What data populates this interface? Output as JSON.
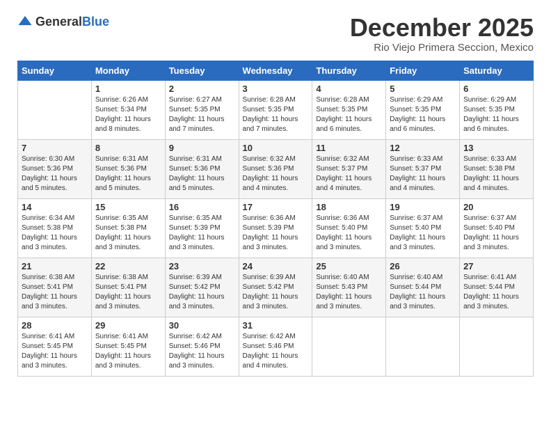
{
  "header": {
    "logo_general": "General",
    "logo_blue": "Blue",
    "month": "December 2025",
    "location": "Rio Viejo Primera Seccion, Mexico"
  },
  "calendar": {
    "weekdays": [
      "Sunday",
      "Monday",
      "Tuesday",
      "Wednesday",
      "Thursday",
      "Friday",
      "Saturday"
    ],
    "weeks": [
      [
        {
          "day": "",
          "info": ""
        },
        {
          "day": "1",
          "info": "Sunrise: 6:26 AM\nSunset: 5:34 PM\nDaylight: 11 hours\nand 8 minutes."
        },
        {
          "day": "2",
          "info": "Sunrise: 6:27 AM\nSunset: 5:35 PM\nDaylight: 11 hours\nand 7 minutes."
        },
        {
          "day": "3",
          "info": "Sunrise: 6:28 AM\nSunset: 5:35 PM\nDaylight: 11 hours\nand 7 minutes."
        },
        {
          "day": "4",
          "info": "Sunrise: 6:28 AM\nSunset: 5:35 PM\nDaylight: 11 hours\nand 6 minutes."
        },
        {
          "day": "5",
          "info": "Sunrise: 6:29 AM\nSunset: 5:35 PM\nDaylight: 11 hours\nand 6 minutes."
        },
        {
          "day": "6",
          "info": "Sunrise: 6:29 AM\nSunset: 5:35 PM\nDaylight: 11 hours\nand 6 minutes."
        }
      ],
      [
        {
          "day": "7",
          "info": "Sunrise: 6:30 AM\nSunset: 5:36 PM\nDaylight: 11 hours\nand 5 minutes."
        },
        {
          "day": "8",
          "info": "Sunrise: 6:31 AM\nSunset: 5:36 PM\nDaylight: 11 hours\nand 5 minutes."
        },
        {
          "day": "9",
          "info": "Sunrise: 6:31 AM\nSunset: 5:36 PM\nDaylight: 11 hours\nand 5 minutes."
        },
        {
          "day": "10",
          "info": "Sunrise: 6:32 AM\nSunset: 5:36 PM\nDaylight: 11 hours\nand 4 minutes."
        },
        {
          "day": "11",
          "info": "Sunrise: 6:32 AM\nSunset: 5:37 PM\nDaylight: 11 hours\nand 4 minutes."
        },
        {
          "day": "12",
          "info": "Sunrise: 6:33 AM\nSunset: 5:37 PM\nDaylight: 11 hours\nand 4 minutes."
        },
        {
          "day": "13",
          "info": "Sunrise: 6:33 AM\nSunset: 5:38 PM\nDaylight: 11 hours\nand 4 minutes."
        }
      ],
      [
        {
          "day": "14",
          "info": "Sunrise: 6:34 AM\nSunset: 5:38 PM\nDaylight: 11 hours\nand 3 minutes."
        },
        {
          "day": "15",
          "info": "Sunrise: 6:35 AM\nSunset: 5:38 PM\nDaylight: 11 hours\nand 3 minutes."
        },
        {
          "day": "16",
          "info": "Sunrise: 6:35 AM\nSunset: 5:39 PM\nDaylight: 11 hours\nand 3 minutes."
        },
        {
          "day": "17",
          "info": "Sunrise: 6:36 AM\nSunset: 5:39 PM\nDaylight: 11 hours\nand 3 minutes."
        },
        {
          "day": "18",
          "info": "Sunrise: 6:36 AM\nSunset: 5:40 PM\nDaylight: 11 hours\nand 3 minutes."
        },
        {
          "day": "19",
          "info": "Sunrise: 6:37 AM\nSunset: 5:40 PM\nDaylight: 11 hours\nand 3 minutes."
        },
        {
          "day": "20",
          "info": "Sunrise: 6:37 AM\nSunset: 5:40 PM\nDaylight: 11 hours\nand 3 minutes."
        }
      ],
      [
        {
          "day": "21",
          "info": "Sunrise: 6:38 AM\nSunset: 5:41 PM\nDaylight: 11 hours\nand 3 minutes."
        },
        {
          "day": "22",
          "info": "Sunrise: 6:38 AM\nSunset: 5:41 PM\nDaylight: 11 hours\nand 3 minutes."
        },
        {
          "day": "23",
          "info": "Sunrise: 6:39 AM\nSunset: 5:42 PM\nDaylight: 11 hours\nand 3 minutes."
        },
        {
          "day": "24",
          "info": "Sunrise: 6:39 AM\nSunset: 5:42 PM\nDaylight: 11 hours\nand 3 minutes."
        },
        {
          "day": "25",
          "info": "Sunrise: 6:40 AM\nSunset: 5:43 PM\nDaylight: 11 hours\nand 3 minutes."
        },
        {
          "day": "26",
          "info": "Sunrise: 6:40 AM\nSunset: 5:44 PM\nDaylight: 11 hours\nand 3 minutes."
        },
        {
          "day": "27",
          "info": "Sunrise: 6:41 AM\nSunset: 5:44 PM\nDaylight: 11 hours\nand 3 minutes."
        }
      ],
      [
        {
          "day": "28",
          "info": "Sunrise: 6:41 AM\nSunset: 5:45 PM\nDaylight: 11 hours\nand 3 minutes."
        },
        {
          "day": "29",
          "info": "Sunrise: 6:41 AM\nSunset: 5:45 PM\nDaylight: 11 hours\nand 3 minutes."
        },
        {
          "day": "30",
          "info": "Sunrise: 6:42 AM\nSunset: 5:46 PM\nDaylight: 11 hours\nand 3 minutes."
        },
        {
          "day": "31",
          "info": "Sunrise: 6:42 AM\nSunset: 5:46 PM\nDaylight: 11 hours\nand 4 minutes."
        },
        {
          "day": "",
          "info": ""
        },
        {
          "day": "",
          "info": ""
        },
        {
          "day": "",
          "info": ""
        }
      ]
    ]
  }
}
